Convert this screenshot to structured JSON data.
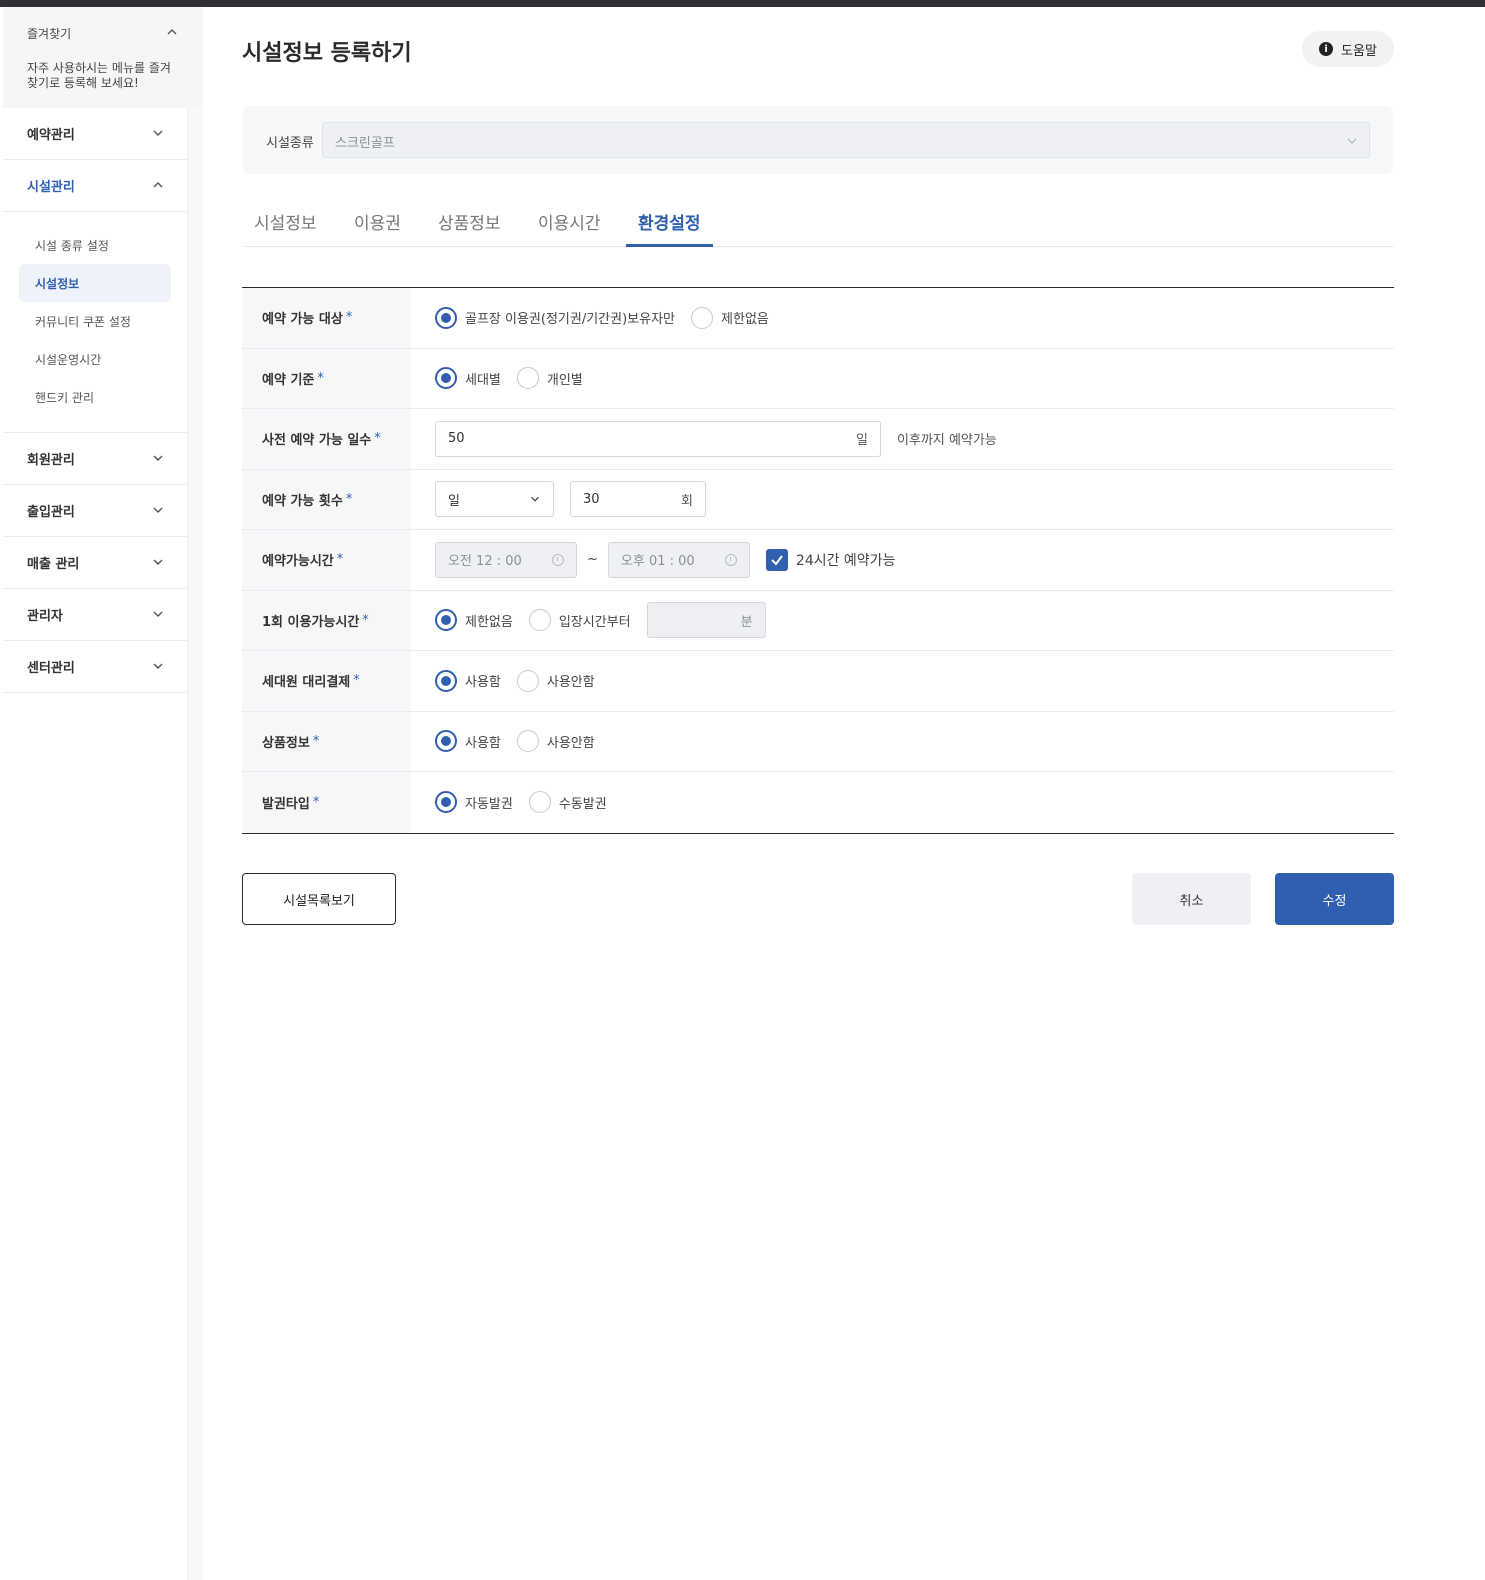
{
  "sidebar": {
    "favorites": {
      "title": "즐겨찾기",
      "description": "자주 사용하시는 메뉴를 즐겨찾기로 등록해 보세요!"
    },
    "menu": [
      {
        "label": "예약관리"
      },
      {
        "label": "시설관리"
      },
      {
        "label": "회원관리"
      },
      {
        "label": "출입관리"
      },
      {
        "label": "매출 관리"
      },
      {
        "label": "관리자"
      },
      {
        "label": "센터관리"
      }
    ],
    "submenu": [
      {
        "label": "시설 종류 설정"
      },
      {
        "label": "시설정보"
      },
      {
        "label": "커뮤니티 쿠폰 설정"
      },
      {
        "label": "시설운영시간"
      },
      {
        "label": "핸드키 관리"
      }
    ]
  },
  "header": {
    "title": "시설정보 등록하기",
    "help_label": "도움말"
  },
  "facility": {
    "label": "시설종류",
    "value": "스크린골프"
  },
  "tabs": [
    {
      "label": "시설정보"
    },
    {
      "label": "이용권"
    },
    {
      "label": "상품정보"
    },
    {
      "label": "이용시간"
    },
    {
      "label": "환경설정"
    }
  ],
  "form": {
    "required_mark": "*",
    "rows": {
      "target": {
        "label": "예약 가능 대상",
        "options": [
          "골프장 이용권(정기권/기간권)보유자만",
          "제한없음"
        ]
      },
      "basis": {
        "label": "예약 기준",
        "options": [
          "세대별",
          "개인별"
        ]
      },
      "advance_days": {
        "label": "사전 예약 가능 일수",
        "value": "50",
        "unit": "일",
        "suffix": "이후까지 예약가능"
      },
      "count": {
        "label": "예약 가능 횟수",
        "period": "일",
        "value": "30",
        "unit": "회"
      },
      "time": {
        "label": "예약가능시간",
        "start": "오전 12 : 00",
        "separator": "~",
        "end": "오후 01 : 00",
        "allday_label": "24시간 예약가능"
      },
      "usage_time": {
        "label": "1회 이용가능시간",
        "options": [
          "제한없음",
          "입장시간부터"
        ],
        "unit": "분"
      },
      "proxy_payment": {
        "label": "세대원 대리결제",
        "options": [
          "사용함",
          "사용안함"
        ]
      },
      "product_info": {
        "label": "상품정보",
        "options": [
          "사용함",
          "사용안함"
        ]
      },
      "ticket_type": {
        "label": "발권타입",
        "options": [
          "자동발권",
          "수동발권"
        ]
      }
    }
  },
  "footer": {
    "list_label": "시설목록보기",
    "cancel_label": "취소",
    "save_label": "수정"
  },
  "colors": {
    "accent": "#2f5fae",
    "topbar": "#2f3033"
  }
}
